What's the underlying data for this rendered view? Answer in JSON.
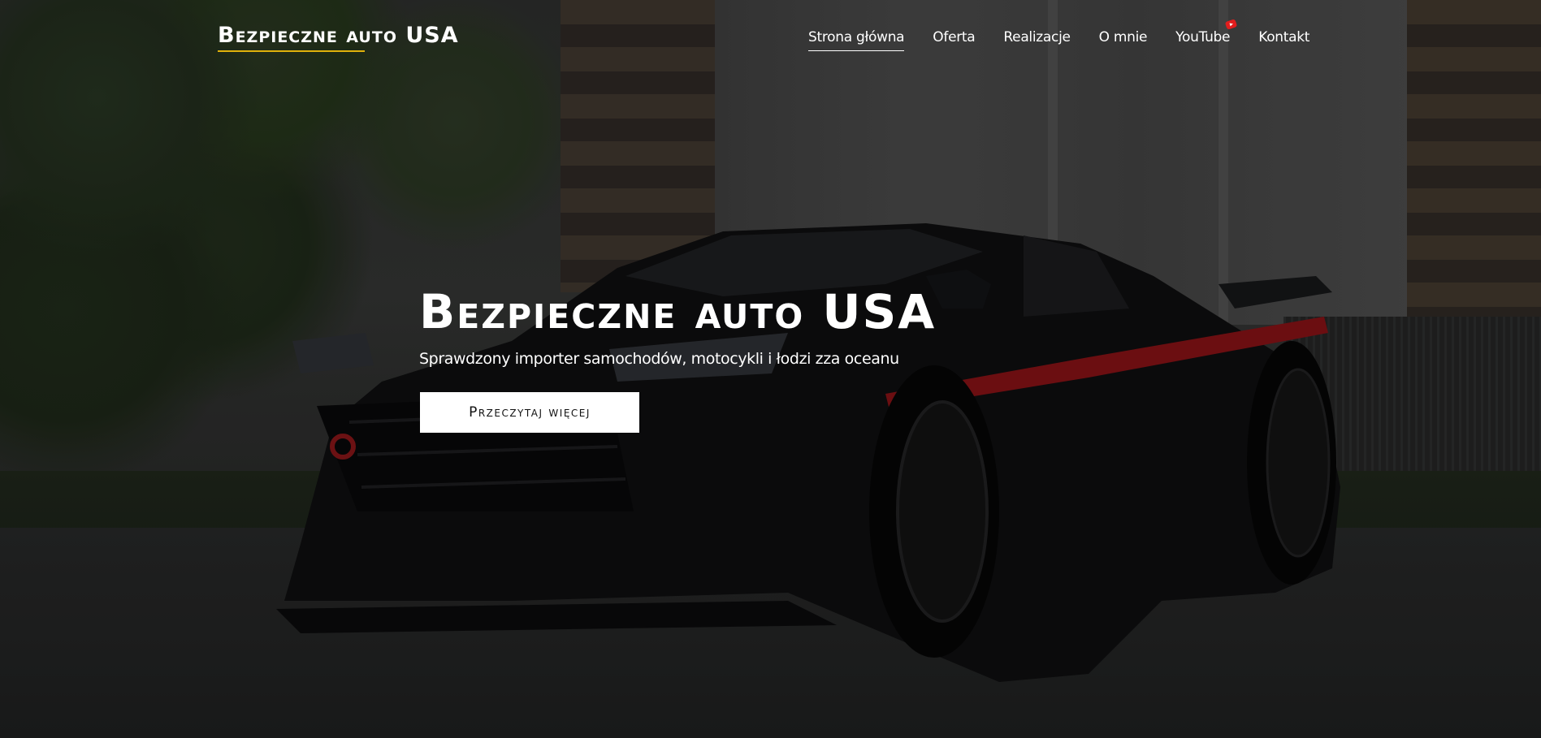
{
  "header": {
    "logo_text": "Bezpieczne auto USA",
    "nav": [
      {
        "label": "Strona główna",
        "active": true
      },
      {
        "label": "Oferta",
        "active": false
      },
      {
        "label": "Realizacje",
        "active": false
      },
      {
        "label": "O mnie",
        "active": false
      },
      {
        "label": "YouTube",
        "active": false,
        "badge_icon": "youtube-icon"
      },
      {
        "label": "Kontakt",
        "active": false
      }
    ]
  },
  "hero": {
    "title": "Bezpieczne auto USA",
    "subtitle": "Sprawdzony importer samochodów, motocykli i łodzi zza oceanu",
    "cta_label": "Przeczytaj więcej",
    "background": "black-sports-car-photo"
  },
  "colors": {
    "logo_underline": "#e0b10b",
    "youtube_badge": "#e11d1d",
    "button_bg": "#ffffff",
    "text": "#ffffff"
  }
}
